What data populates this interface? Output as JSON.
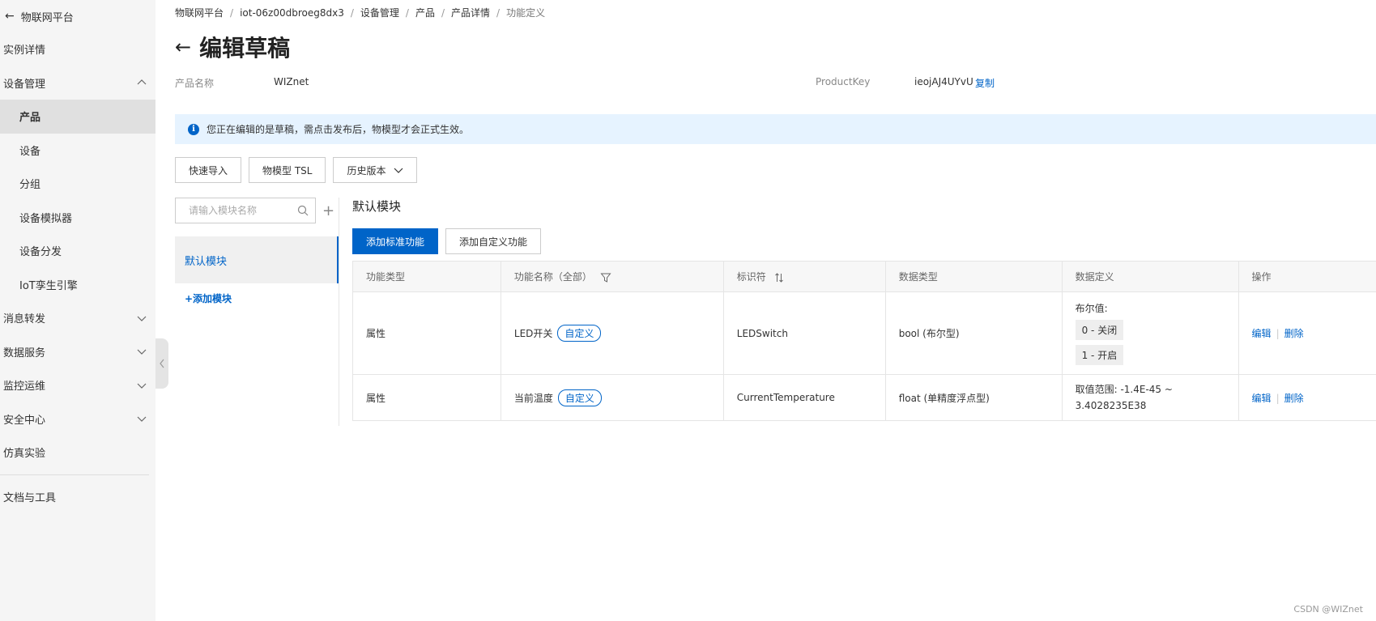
{
  "sidebar": {
    "header": "物联网平台",
    "items": [
      {
        "label": "实例详情"
      },
      {
        "label": "设备管理"
      },
      {
        "label": "产品"
      },
      {
        "label": "设备"
      },
      {
        "label": "分组"
      },
      {
        "label": "设备模拟器"
      },
      {
        "label": "设备分发"
      },
      {
        "label": "IoT孪生引擎"
      },
      {
        "label": "消息转发"
      },
      {
        "label": "数据服务"
      },
      {
        "label": "监控运维"
      },
      {
        "label": "安全中心"
      },
      {
        "label": "仿真实验"
      },
      {
        "label": "文档与工具"
      }
    ]
  },
  "breadcrumb": [
    "物联网平台",
    "iot-06z00dbroeg8dx3",
    "设备管理",
    "产品",
    "产品详情",
    "功能定义"
  ],
  "page": {
    "title": "编辑草稿",
    "product_name_label": "产品名称",
    "product_name": "WIZnet",
    "product_key_label": "ProductKey",
    "product_key": "ieojAJ4UYvU",
    "copy": "复制"
  },
  "notice": "您正在编辑的是草稿，需点击发布后，物模型才会正式生效。",
  "toolbar": {
    "quick_import": "快速导入",
    "tsl": "物模型 TSL",
    "history": "历史版本"
  },
  "modules": {
    "search_placeholder": "请输入模块名称",
    "default": "默认模块",
    "add": "+添加模块"
  },
  "content": {
    "title": "默认模块",
    "add_standard": "添加标准功能",
    "add_custom": "添加自定义功能",
    "columns": [
      "功能类型",
      "功能名称（全部）",
      "标识符",
      "数据类型",
      "数据定义",
      "操作"
    ],
    "rows": [
      {
        "type": "属性",
        "name": "LED开关",
        "tag": "自定义",
        "identifier": "LEDSwitch",
        "data_type": "bool (布尔型)",
        "def_title": "布尔值:",
        "enum0": "0 - 关闭",
        "enum1": "1 - 开启",
        "edit": "编辑",
        "delete": "删除"
      },
      {
        "type": "属性",
        "name": "当前温度",
        "tag": "自定义",
        "identifier": "CurrentTemperature",
        "data_type": "float (单精度浮点型)",
        "def_range": "取值范围: -1.4E-45 ~ 3.4028235E38",
        "edit": "编辑",
        "delete": "删除"
      }
    ]
  },
  "watermark": "CSDN @WIZnet"
}
